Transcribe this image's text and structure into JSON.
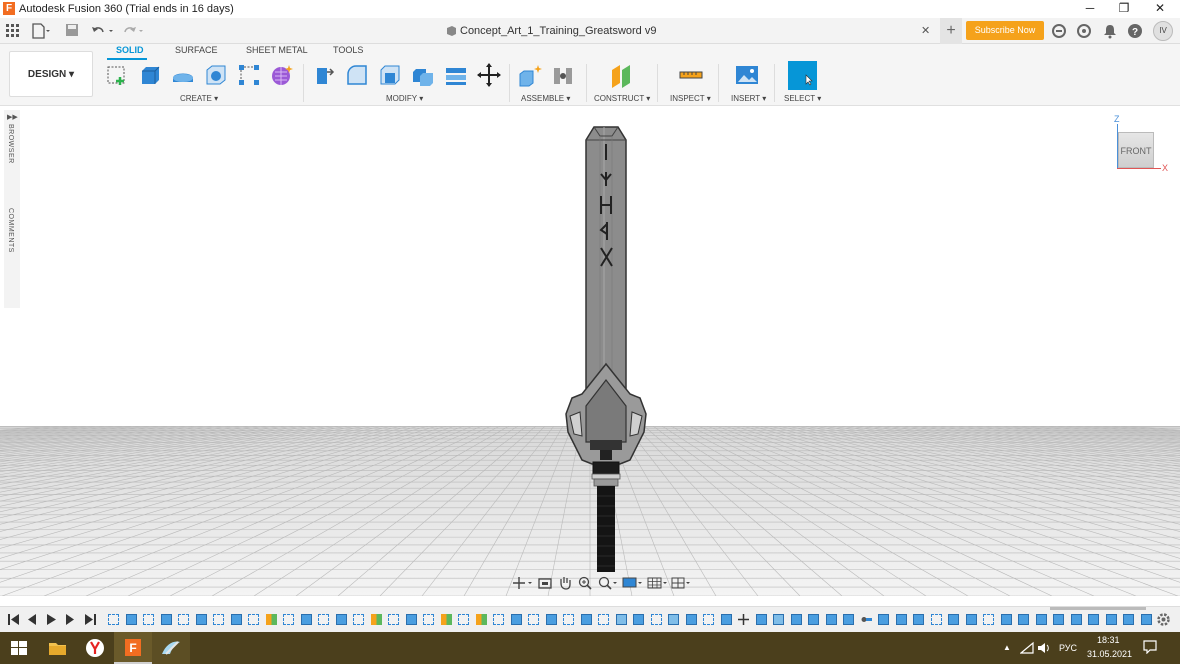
{
  "window": {
    "title": "Autodesk Fusion 360 (Trial ends in 16 days)",
    "app_icon_letter": "F",
    "minimize": "─",
    "restore": "❐",
    "close": "✕"
  },
  "appbar": {
    "document_title": "Concept_Art_1_Training_Greatsword v9",
    "close_tab": "✕",
    "new_tab": "+",
    "subscribe_label": "Subscribe Now",
    "avatar_initials": "IV"
  },
  "toolbar": {
    "workspace_label": "DESIGN ▾",
    "tabs": [
      "SOLID",
      "SURFACE",
      "SHEET METAL",
      "TOOLS"
    ],
    "active_tab": "SOLID",
    "groups": {
      "create": "CREATE ▾",
      "modify": "MODIFY ▾",
      "assemble": "ASSEMBLE ▾",
      "construct": "CONSTRUCT ▾",
      "inspect": "INSPECT ▾",
      "insert": "INSERT ▾",
      "select": "SELECT ▾"
    }
  },
  "side_panels": {
    "browser": "BROWSER",
    "comments": "COMMENTS"
  },
  "viewcube": {
    "face": "FRONT",
    "axis_z": "Z",
    "axis_x": "X"
  },
  "model": {
    "runes": [
      "I",
      "ᛉ",
      "H",
      "ᛩ",
      "X"
    ]
  },
  "taskbar": {
    "language": "РУС",
    "time": "18:31",
    "date": "31.05.2021"
  },
  "colors": {
    "accent": "#0696d7",
    "subscribe": "#f5a21b",
    "taskbar": "#4b3f1c",
    "blade": "#8a8a8a",
    "grip": "#1a1a1a"
  }
}
